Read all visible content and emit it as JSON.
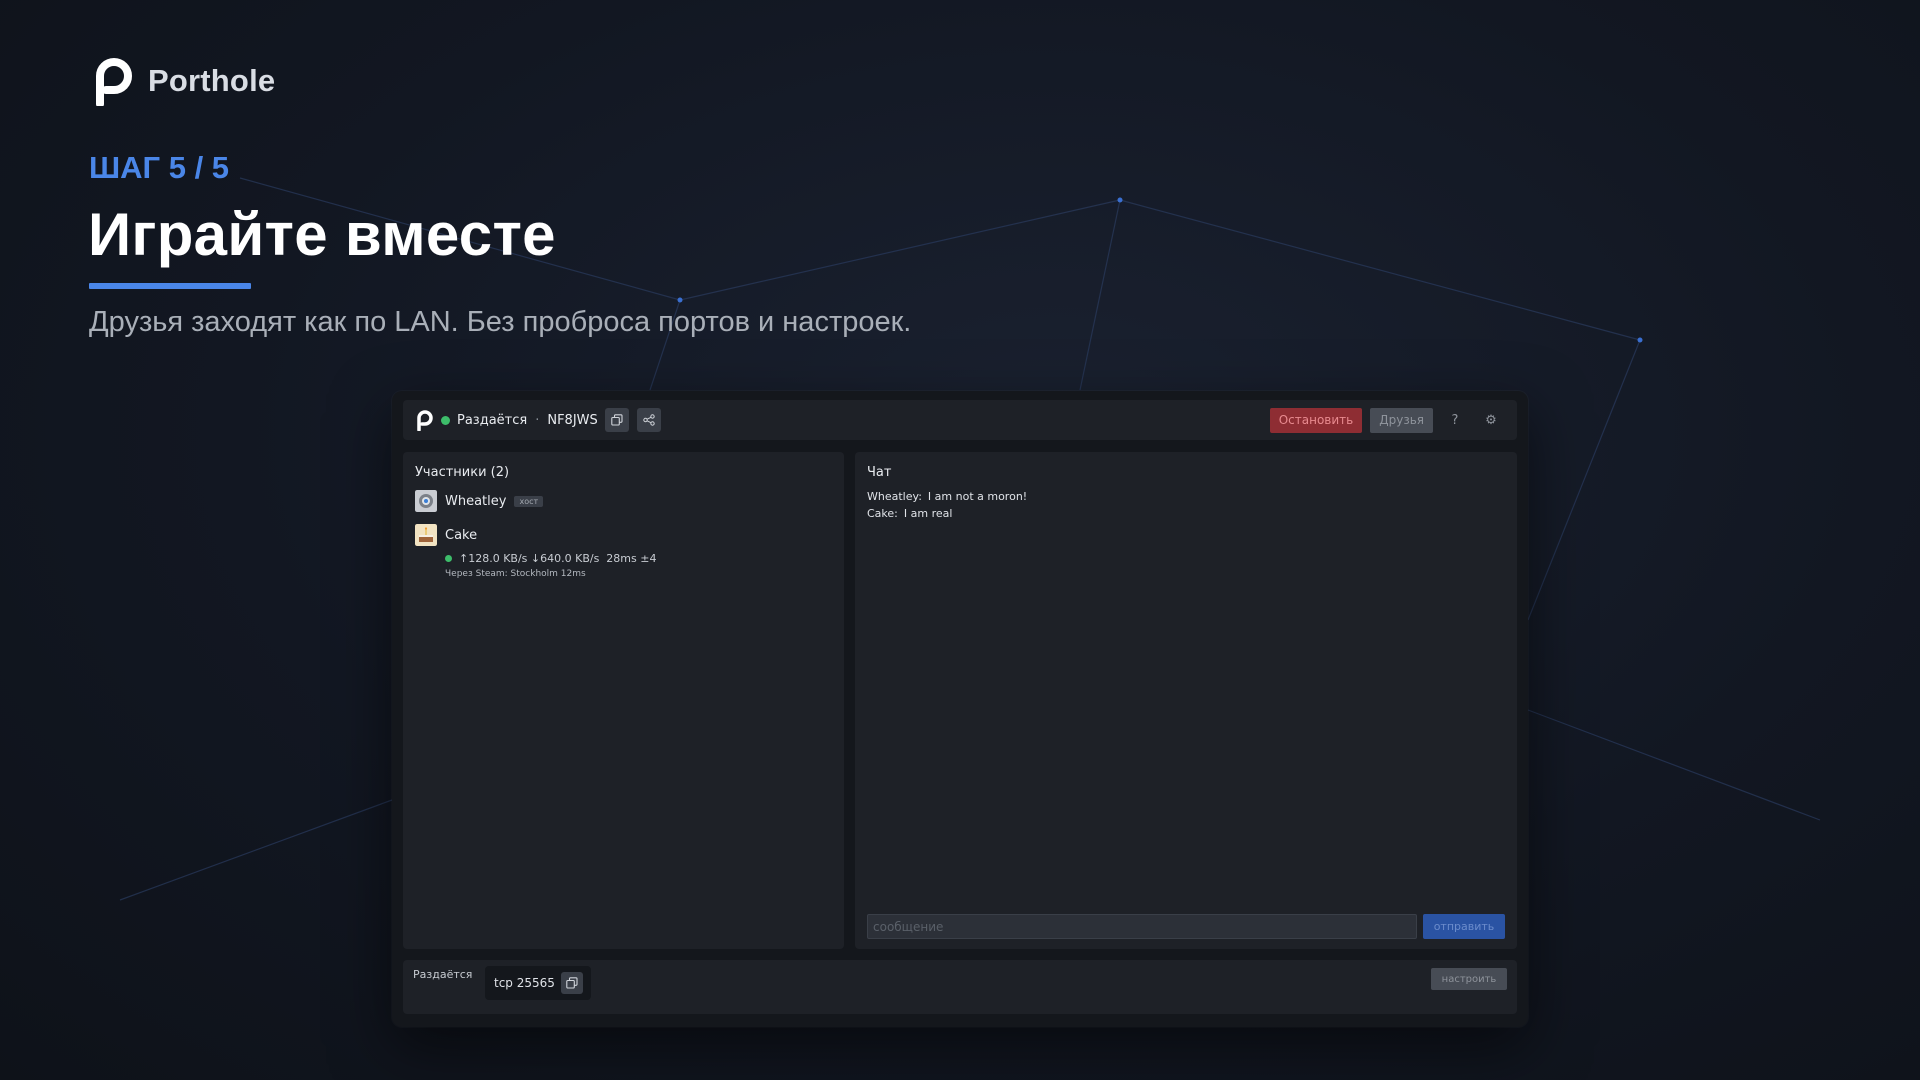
{
  "slide": {
    "brand_name": "Porthole",
    "step": "ШАГ 5 / 5",
    "headline": "Играйте вместе",
    "subtitle": "Друзья заходят как по LAN. Без проброса портов и настроек.",
    "accent_color": "#4a86e8"
  },
  "app": {
    "topbar": {
      "status": "Раздаётся",
      "separator": "·",
      "room_code": "NF8JWS",
      "copy_icon": "copy-icon",
      "share_icon": "share-icon",
      "stop_label": "Остановить",
      "friends_label": "Друзья",
      "help_label": "?",
      "settings_label": "⚙"
    },
    "participants": {
      "title": "Участники (2)",
      "items": [
        {
          "name": "Wheatley",
          "badge": "хост",
          "avatar": "wheatley-avatar"
        },
        {
          "name": "Cake",
          "avatar": "cake-avatar",
          "stats": "↑128.0 KB/s ↓640.0 KB/s  28ms ±4",
          "route": "Через Steam: Stockholm 12ms"
        }
      ]
    },
    "chat": {
      "title": "Чат",
      "messages": [
        {
          "author": "Wheatley:",
          "text": "I am not a moron!"
        },
        {
          "author": "Cake:",
          "text": "I am real"
        }
      ],
      "input_placeholder": "сообщение",
      "send_label": "отправить"
    },
    "hosted": {
      "label": "Раздаётся",
      "port": "tcp 25565",
      "configure_label": "настроить"
    },
    "colors": {
      "online": "#3dbd6a",
      "stop": "#8e2d33",
      "send": "#2a53a3"
    }
  }
}
